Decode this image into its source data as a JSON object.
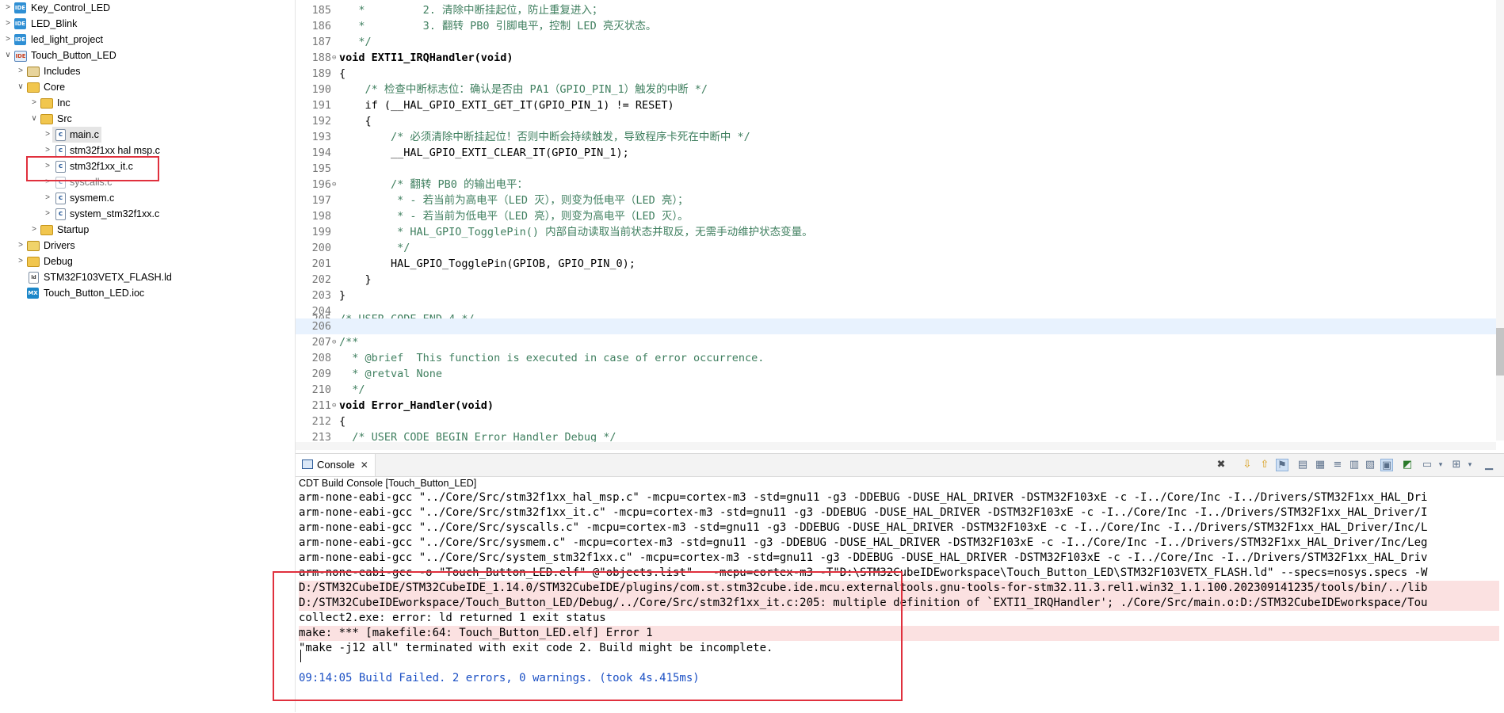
{
  "explorer": {
    "items": [
      {
        "label": "Key_Control_LED",
        "icon": "ide-project-icon"
      },
      {
        "label": "LED_Blink",
        "icon": "ide-project-icon"
      },
      {
        "label": "led_light_project",
        "icon": "ide-project-icon"
      },
      {
        "label": "Touch_Button_LED",
        "icon": "stm32-project-icon"
      },
      {
        "label": "Includes",
        "icon": "includes-icon"
      },
      {
        "label": "Core",
        "icon": "source-folder-icon"
      },
      {
        "label": "Inc",
        "icon": "folder-icon"
      },
      {
        "label": "Src",
        "icon": "source-folder-icon"
      },
      {
        "label": "main.c",
        "icon": "c-file-icon"
      },
      {
        "label": "stm32f1xx hal msp.c",
        "icon": "c-file-icon"
      },
      {
        "label": "stm32f1xx_it.c",
        "icon": "c-file-icon"
      },
      {
        "label": "syscalls.c",
        "icon": "c-file-icon"
      },
      {
        "label": "sysmem.c",
        "icon": "c-file-icon"
      },
      {
        "label": "system_stm32f1xx.c",
        "icon": "c-file-icon"
      },
      {
        "label": "Startup",
        "icon": "folder-icon"
      },
      {
        "label": "Drivers",
        "icon": "package-folder-icon"
      },
      {
        "label": "Debug",
        "icon": "folder-icon"
      },
      {
        "label": "STM32F103VETX_FLASH.ld",
        "icon": "ld-file-icon"
      },
      {
        "label": "Touch_Button_LED.ioc",
        "icon": "mx-file-icon"
      }
    ]
  },
  "editor": {
    "lines": [
      {
        "n": "185",
        "text": "   *         2. 清除中断挂起位，防止重复进入；"
      },
      {
        "n": "186",
        "text": "   *         3. 翻转 PB0 引脚电平，控制 LED 亮灭状态。"
      },
      {
        "n": "187",
        "text": "   */"
      },
      {
        "n": "188",
        "text": "void EXTI1_IRQHandler(void)"
      },
      {
        "n": "189",
        "text": "{"
      },
      {
        "n": "190",
        "text": "    /* 检查中断标志位：确认是否由 PA1（GPIO_PIN_1）触发的中断 */"
      },
      {
        "n": "191",
        "text": "    if (__HAL_GPIO_EXTI_GET_IT(GPIO_PIN_1) != RESET)"
      },
      {
        "n": "192",
        "text": "    {"
      },
      {
        "n": "193",
        "text": "        /* 必须清除中断挂起位！否则中断会持续触发，导致程序卡死在中断中 */"
      },
      {
        "n": "194",
        "text": "        __HAL_GPIO_EXTI_CLEAR_IT(GPIO_PIN_1);"
      },
      {
        "n": "195",
        "text": ""
      },
      {
        "n": "196",
        "text": "        /* 翻转 PB0 的输出电平："
      },
      {
        "n": "197",
        "text": "         * - 若当前为高电平（LED 灭），则变为低电平（LED 亮）；"
      },
      {
        "n": "198",
        "text": "         * - 若当前为低电平（LED 亮），则变为高电平（LED 灭）。"
      },
      {
        "n": "199",
        "text": "         * HAL_GPIO_TogglePin() 内部自动读取当前状态并取反，无需手动维护状态变量。"
      },
      {
        "n": "200",
        "text": "         */"
      },
      {
        "n": "201",
        "text": "        HAL_GPIO_TogglePin(GPIOB, GPIO_PIN_0);"
      },
      {
        "n": "202",
        "text": "    }"
      },
      {
        "n": "203",
        "text": "}"
      },
      {
        "n": "204",
        "text": ""
      },
      {
        "n": "205",
        "text": "/* USER CODE END 4 */"
      },
      {
        "n": "206",
        "text": ""
      },
      {
        "n": "207",
        "text": "/**"
      },
      {
        "n": "208",
        "text": "  * @brief  This function is executed in case of error occurrence."
      },
      {
        "n": "209",
        "text": "  * @retval None"
      },
      {
        "n": "210",
        "text": "  */"
      },
      {
        "n": "211",
        "text": "void Error_Handler(void)"
      },
      {
        "n": "212",
        "text": "{"
      },
      {
        "n": "213",
        "text": "  /* USER CODE BEGIN Error Handler Debug */"
      }
    ]
  },
  "console": {
    "tab_label": "Console",
    "close_glyph": "✕",
    "title": "CDT Build Console [Touch_Button_LED]",
    "lines": [
      "arm-none-eabi-gcc \"../Core/Src/stm32f1xx_hal_msp.c\" -mcpu=cortex-m3 -std=gnu11 -g3 -DDEBUG -DUSE_HAL_DRIVER -DSTM32F103xE -c -I../Core/Inc -I../Drivers/STM32F1xx_HAL_Dri",
      "arm-none-eabi-gcc \"../Core/Src/stm32f1xx_it.c\" -mcpu=cortex-m3 -std=gnu11 -g3 -DDEBUG -DUSE_HAL_DRIVER -DSTM32F103xE -c -I../Core/Inc -I../Drivers/STM32F1xx_HAL_Driver/I",
      "arm-none-eabi-gcc \"../Core/Src/syscalls.c\" -mcpu=cortex-m3 -std=gnu11 -g3 -DDEBUG -DUSE_HAL_DRIVER -DSTM32F103xE -c -I../Core/Inc -I../Drivers/STM32F1xx_HAL_Driver/Inc/L",
      "arm-none-eabi-gcc \"../Core/Src/sysmem.c\" -mcpu=cortex-m3 -std=gnu11 -g3 -DDEBUG -DUSE_HAL_DRIVER -DSTM32F103xE -c -I../Core/Inc -I../Drivers/STM32F1xx_HAL_Driver/Inc/Leg",
      "arm-none-eabi-gcc \"../Core/Src/system_stm32f1xx.c\" -mcpu=cortex-m3 -std=gnu11 -g3 -DDEBUG -DUSE_HAL_DRIVER -DSTM32F103xE -c -I../Core/Inc -I../Drivers/STM32F1xx_HAL_Driv",
      "arm-none-eabi-gcc -o \"Touch_Button_LED.elf\" @\"objects.list\"   -mcpu=cortex-m3 -T\"D:\\STM32CubeIDEworkspace\\Touch_Button_LED\\STM32F103VETX_FLASH.ld\" --specs=nosys.specs -W",
      "D:/STM32CubeIDE/STM32CubeIDE_1.14.0/STM32CubeIDE/plugins/com.st.stm32cube.ide.mcu.externaltools.gnu-tools-for-stm32.11.3.rel1.win32_1.1.100.202309141235/tools/bin/../lib",
      "D:/STM32CubeIDEworkspace/Touch_Button_LED/Debug/../Core/Src/stm32f1xx_it.c:205: multiple definition of `EXTI1_IRQHandler'; ./Core/Src/main.o:D:/STM32CubeIDEworkspace/Tou",
      "collect2.exe: error: ld returned 1 exit status",
      "make: *** [makefile:64: Touch_Button_LED.elf] Error 1",
      "\"make -j12 all\" terminated with exit code 2. Build might be incomplete.",
      "",
      "09:14:05 Build Failed. 2 errors, 0 warnings. (took 4s.415ms)"
    ]
  },
  "colors": {
    "highlight_box": "#e0303d",
    "comment": "#3f7f5f",
    "keyword": "#7f0055",
    "error_line_bg": "#fbe1e1",
    "build_failed_text": "#1a4fc4"
  }
}
